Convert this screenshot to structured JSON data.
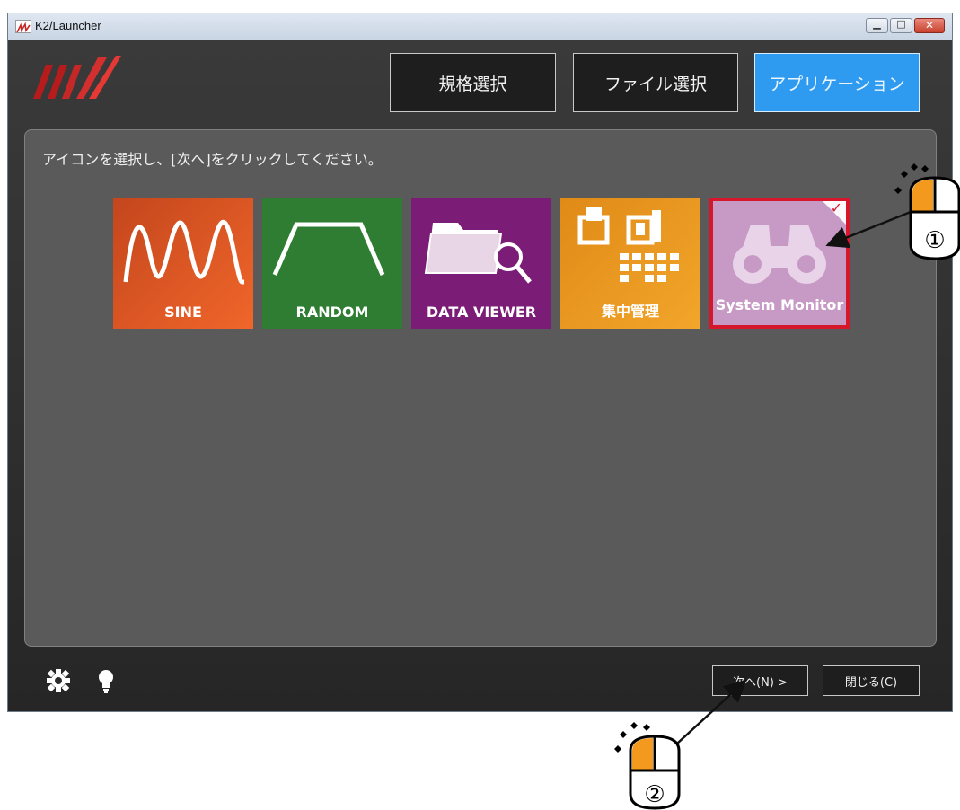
{
  "window": {
    "title": "K2/Launcher"
  },
  "tabs": [
    {
      "label": "規格選択"
    },
    {
      "label": "ファイル選択"
    },
    {
      "label": "アプリケーション"
    }
  ],
  "instruction": "アイコンを選択し、[次へ]をクリックしてください。",
  "tiles": [
    {
      "label": "SINE",
      "color": "#e2541f"
    },
    {
      "label": "RANDOM",
      "color": "#2e7d32"
    },
    {
      "label": "DATA VIEWER",
      "color": "#7b1c77"
    },
    {
      "label": "集中管理",
      "color": "#ee9a1c"
    },
    {
      "label": "System Monitor",
      "color": "#c79ac6",
      "selected": true
    }
  ],
  "buttons": {
    "next": "次へ(N) >",
    "close": "閉じる(C)"
  },
  "callouts": {
    "step1": "①",
    "step2": "②"
  },
  "colors": {
    "accent": "#2f9bf0",
    "selection": "#d6162b",
    "mouse_button": "#f39a1e"
  }
}
